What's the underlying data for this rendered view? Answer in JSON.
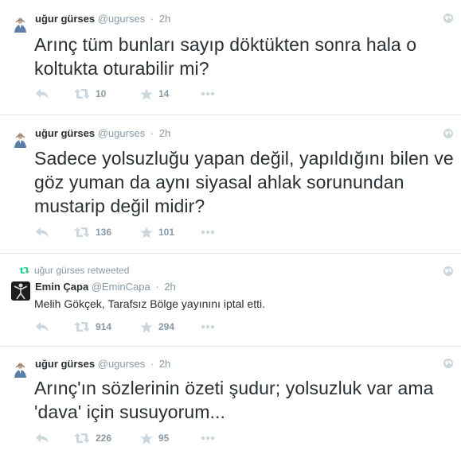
{
  "tweets": [
    {
      "fullname": "uğur gürses",
      "username": "@ugurses",
      "time": "2h",
      "text": "Arınç tüm bunları sayıp döktükten sonra hala o koltukta oturabilir mi?",
      "retweets": "10",
      "favorites": "14"
    },
    {
      "fullname": "uğur gürses",
      "username": "@ugurses",
      "time": "2h",
      "text": "Sadece yolsuzluğu yapan değil, yapıldığını bilen ve göz yuman da aynı siyasal ahlak sorunundan mustarip değil midir?",
      "retweets": "136",
      "favorites": "101"
    },
    {
      "retweeted_by": "uğur gürses retweeted",
      "fullname": "Emin Çapa",
      "username": "@EminCapa",
      "time": "2h",
      "text": "Melih Gökçek, Tarafsız Bölge yayınını iptal etti.",
      "retweets": "914",
      "favorites": "294"
    },
    {
      "fullname": "uğur gürses",
      "username": "@ugurses",
      "time": "2h",
      "text": "Arınç'ın sözlerinin özeti şudur; yolsuzluk var ama 'dava' için susuyorum...",
      "retweets": "226",
      "favorites": "95"
    }
  ],
  "icons": {
    "reply": "reply-icon",
    "retweet": "retweet-icon",
    "favorite": "star-icon",
    "more": "more-icon",
    "globe": "globe-icon"
  },
  "colors": {
    "text": "#292f33",
    "muted": "#8899a6",
    "retweet_green": "#19cf86",
    "divider": "#e1e8ed"
  }
}
